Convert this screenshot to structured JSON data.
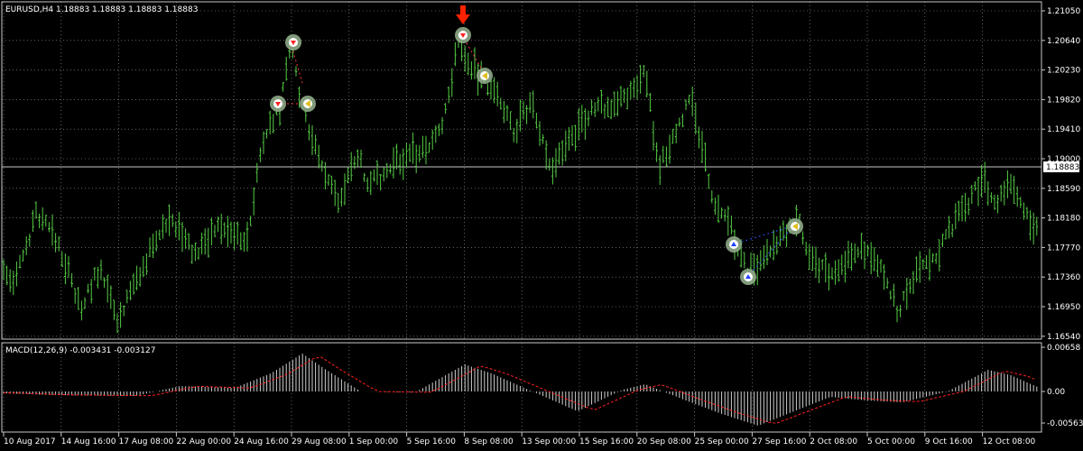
{
  "main_chart": {
    "symbol_label": "EURUSD,H4  1.18883 1.18883 1.18883 1.18883",
    "current_price": "1.18883",
    "price_ticks": [
      "1.21050",
      "1.20640",
      "1.20230",
      "1.19820",
      "1.19410",
      "1.19000",
      "1.18590",
      "1.18180",
      "1.17770",
      "1.17360",
      "1.16950",
      "1.16540"
    ],
    "grid": true
  },
  "macd_panel": {
    "label": "MACD(12,26,9) -0.003431 -0.003127",
    "ticks": [
      "0.00658",
      "0.00",
      "-0.005631"
    ]
  },
  "time_axis": {
    "labels": [
      "10 Aug 2017",
      "14 Aug 16:00",
      "17 Aug 08:00",
      "22 Aug 00:00",
      "24 Aug 16:00",
      "29 Aug 08:00",
      "1 Sep 00:00",
      "5 Sep 16:00",
      "8 Sep 08:00",
      "13 Sep 00:00",
      "15 Sep 16:00",
      "20 Sep 08:00",
      "25 Sep 00:00",
      "27 Sep 16:00",
      "2 Oct 08:00",
      "5 Oct 00:00",
      "9 Oct 16:00",
      "12 Oct 08:00"
    ]
  },
  "colors": {
    "background": "#000000",
    "bars": "#55cc44",
    "grid": "#c8c8c8",
    "axis_text": "#ffffff",
    "signal_line": "#ff2020",
    "histogram": "#d0d0d0",
    "arrow": "#ff2200",
    "marker_ring": "#8faa88"
  },
  "markers": [
    {
      "kind": "sell",
      "icon": "sell-marker-icon"
    },
    {
      "kind": "sell",
      "icon": "sell-marker-icon"
    },
    {
      "kind": "close",
      "icon": "close-marker-icon"
    },
    {
      "kind": "sell",
      "icon": "sell-marker-icon"
    },
    {
      "kind": "close",
      "icon": "close-marker-icon"
    },
    {
      "kind": "buy",
      "icon": "buy-marker-icon"
    },
    {
      "kind": "buy",
      "icon": "buy-marker-icon"
    },
    {
      "kind": "close",
      "icon": "close-marker-icon"
    }
  ],
  "signal_arrow": {
    "icon": "down-arrow-icon",
    "direction": "down"
  }
}
